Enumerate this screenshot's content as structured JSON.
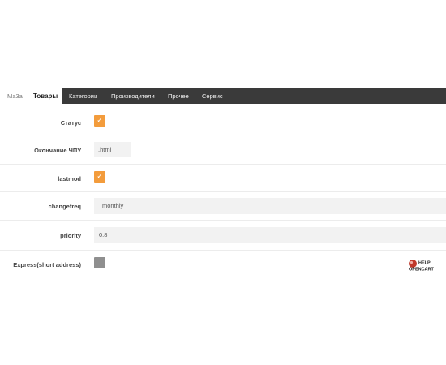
{
  "tabs": [
    {
      "label": "Ма3а",
      "state": "partial"
    },
    {
      "label": "Товары",
      "state": "active"
    },
    {
      "label": "Категории",
      "state": "normal"
    },
    {
      "label": "Производители",
      "state": "normal"
    },
    {
      "label": "Прочее",
      "state": "normal"
    },
    {
      "label": "Сервис",
      "state": "normal"
    }
  ],
  "form": {
    "status": {
      "label": "Статус",
      "checked": true
    },
    "seo_suffix": {
      "label": "Окончание ЧПУ",
      "value": ".html"
    },
    "lastmod": {
      "label": "lastmod",
      "checked": true
    },
    "changefreq": {
      "label": "changefreq",
      "value": "monthly"
    },
    "priority": {
      "label": "priority",
      "value": "0.8"
    },
    "express": {
      "label": "Express(short address)",
      "checked": false
    }
  },
  "logo": {
    "line1": "HELP",
    "line2": "OPENCART"
  },
  "colors": {
    "tabbar": "#3a3a3a",
    "checkbox_on": "#f39c3c",
    "checkbox_off": "#8f8f8f",
    "field_bg": "#f2f2f2"
  }
}
